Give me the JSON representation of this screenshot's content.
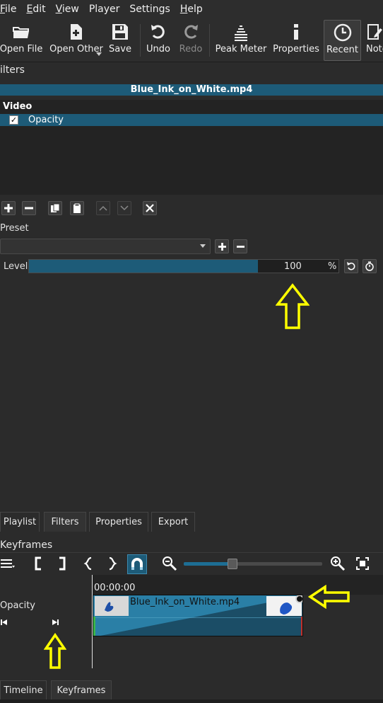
{
  "menu": {
    "items": [
      {
        "pre": "",
        "u": "F",
        "post": "ile"
      },
      {
        "pre": "",
        "u": "E",
        "post": "dit"
      },
      {
        "pre": "",
        "u": "V",
        "post": "iew"
      },
      {
        "pre": "Player",
        "u": "",
        "post": ""
      },
      {
        "pre": "Settings",
        "u": "",
        "post": ""
      },
      {
        "pre": "",
        "u": "H",
        "post": "elp"
      }
    ]
  },
  "toolbar": {
    "open_file": "Open File",
    "open_other": "Open Other",
    "save": "Save",
    "undo": "Undo",
    "redo": "Redo",
    "peak_meter": "Peak Meter",
    "properties": "Properties",
    "recent": "Recent",
    "notes": "Note"
  },
  "filters": {
    "dock_title": "ilters",
    "clip_name": "Blue_Ink_on_White.mp4",
    "video_header": "Video",
    "items": [
      {
        "name": "Opacity",
        "checked": true
      }
    ],
    "preset_label": "Preset",
    "preset_value": "",
    "level_label": "Level",
    "level_value": "100",
    "level_unit": "%",
    "level_fraction": 0.74
  },
  "tabs_mid": [
    "Playlist",
    "Filters",
    "Properties",
    "Export"
  ],
  "tabs_mid_active": 1,
  "keyframes": {
    "dock_title": "Keyframes",
    "time": "00:00:00",
    "parameter": "Opacity",
    "clip_name": "Blue_Ink_on_White.mp4",
    "zoom_fraction": 0.35
  },
  "tabs_bottom": [
    "Timeline",
    "Keyframes"
  ],
  "tabs_bottom_active": 1,
  "colors": {
    "selection": "#1d5b78",
    "annotation_arrow": "#ffff00"
  }
}
